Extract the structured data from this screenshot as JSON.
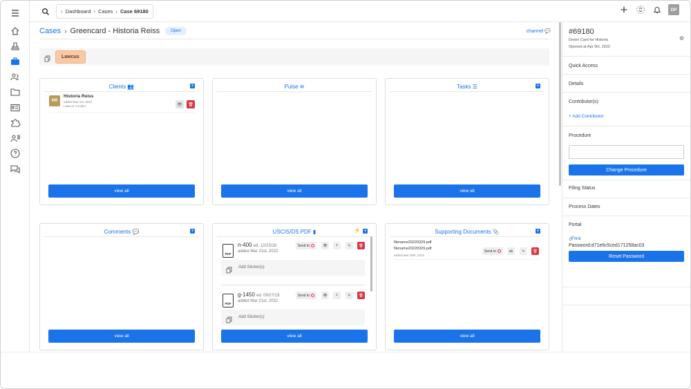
{
  "sidebar": {
    "icons": [
      "menu-icon",
      "home-icon",
      "stamp-icon",
      "briefcase-icon",
      "users-icon",
      "folder-icon",
      "id-card-icon",
      "puzzle-icon",
      "broadcast-icon",
      "help-icon",
      "chat-icon"
    ],
    "active": "briefcase-icon"
  },
  "topbar": {
    "breadcrumb": [
      "Dashboard",
      "Cases",
      "Case 69180"
    ],
    "avatar_initials": "DP"
  },
  "header": {
    "crumb_root": "Cases",
    "title": "Greencard - Historia Reiss",
    "status": "Open",
    "channel_link": "channel"
  },
  "tag": "Lawcus",
  "cards": {
    "clients": {
      "title": "Clients",
      "client": {
        "initials": "HR",
        "name": "Historia Reiss",
        "added": "added Mar 1st, 2022",
        "role": "Lawcus Contact"
      },
      "view_all": "view all"
    },
    "pulse": {
      "title": "Pulse",
      "view_all": "view all"
    },
    "tasks": {
      "title": "Tasks",
      "view_all": "view all"
    },
    "comments": {
      "title": "Comments",
      "view_all": "view all"
    },
    "uscis": {
      "title": "USCIS/DS PDF",
      "pdf_label": "PDF",
      "send_to": "Send to",
      "sticker_placeholder": "Add Sticker(s)",
      "items": [
        {
          "name": "n-400",
          "edition": "ed. 12/23/16",
          "added": "added Mar 21st, 2022"
        },
        {
          "name": "g-1450",
          "edition": "ed. 09/27/19",
          "added": "added Mar 21st, 2022"
        }
      ],
      "view_all": "view all"
    },
    "supporting": {
      "title": "Supporting Documents",
      "files": [
        "filename20220329.pdf",
        "filename20220329.pdf"
      ],
      "added": "added Mar 29th, 2022",
      "send_to": "Send to",
      "view_all": "view all"
    }
  },
  "right_panel": {
    "case_id": "#69180",
    "case_desc": "Green Card for Historia",
    "opened": "Opened at Apr 5th, 2022",
    "quick_access": "Quick Access",
    "details": "Details",
    "contributors": "Contributor(s)",
    "add_contributor": "Add Contributor",
    "procedure": "Procedure",
    "procedure_value": "",
    "change_procedure": "Change Procedure",
    "filing_status": "Filing Status",
    "process_dates": "Process Dates",
    "portal": "Portal",
    "portal_link": "link",
    "password": "Password:d71e6c5ced171258ac03",
    "reset_password": "Reset Password"
  },
  "colors": {
    "accent": "#1a73e8",
    "danger": "#dc3545",
    "tag_bg": "#f9c9a6",
    "client_avatar": "#b99a59"
  }
}
